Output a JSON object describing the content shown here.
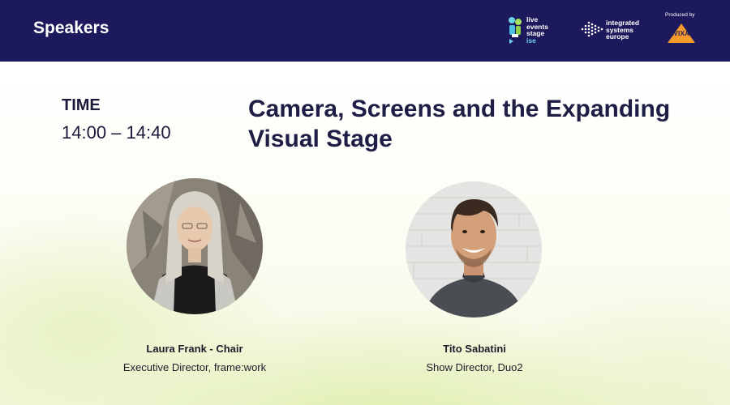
{
  "header": {
    "title": "Speakers",
    "logos": {
      "les_lines": [
        "live",
        "events",
        "stage",
        "ise"
      ],
      "ise_lines": [
        "integrated",
        "systems",
        "europe"
      ],
      "produced_by": "Produced by",
      "avixa": "AVIXA"
    }
  },
  "session": {
    "time_label": "TIME",
    "time_value": "14:00 – 14:40",
    "title": "Camera, Screens and the Expanding Visual Stage"
  },
  "speakers": [
    {
      "name": "Laura Frank - Chair",
      "role": "Executive Director, frame:work"
    },
    {
      "name": "Tito Sabatini",
      "role": "Show Director, Duo2"
    }
  ],
  "colors": {
    "header_bg": "#1c1a5c",
    "title_text": "#1e1d45",
    "accent_green": "#d6e896",
    "avixa_orange": "#f39a2b"
  }
}
